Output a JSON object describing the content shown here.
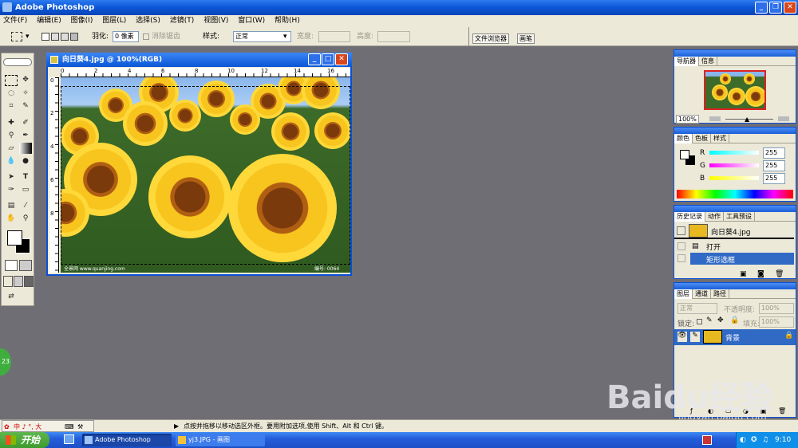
{
  "app": {
    "title": "Adobe Photoshop"
  },
  "menu": [
    "文件(F)",
    "编辑(E)",
    "图像(I)",
    "图层(L)",
    "选择(S)",
    "滤镜(T)",
    "视图(V)",
    "窗口(W)",
    "帮助(H)"
  ],
  "options": {
    "feather_label": "羽化:",
    "feather_value": "0 像素",
    "antialias_label": "消除锯齿",
    "style_label": "样式:",
    "style_value": "正常",
    "width_label": "宽度:",
    "height_label": "高度:",
    "palette_well": [
      "文件浏览器",
      "画笔"
    ]
  },
  "document": {
    "title": "向日葵4.jpg @ 100%(RGB)",
    "ruler_marks": [
      "0",
      "2",
      "4",
      "6",
      "8",
      "10",
      "12",
      "14",
      "16"
    ],
    "v_ruler_marks": [
      "0",
      "2",
      "4",
      "6",
      "8"
    ],
    "watermark_left": "全景网 www.quanjing.com",
    "watermark_right": "编号: 0064"
  },
  "navigator": {
    "tabs": [
      "导航器",
      "信息"
    ],
    "zoom": "100%"
  },
  "color": {
    "tabs": [
      "颜色",
      "色板",
      "样式"
    ],
    "channels": [
      {
        "label": "R",
        "value": "255",
        "color": "#e0302a"
      },
      {
        "label": "G",
        "value": "255",
        "color": "#2fb53a"
      },
      {
        "label": "B",
        "value": "255",
        "color": "#2a3fe0"
      }
    ]
  },
  "history": {
    "tabs": [
      "历史记录",
      "动作",
      "工具预设"
    ],
    "snapshot": "向日葵4.jpg",
    "items": [
      "打开",
      "矩形选框"
    ]
  },
  "layers": {
    "tabs": [
      "图层",
      "通道",
      "路径"
    ],
    "blend_mode": "正常",
    "opacity_label": "不透明度:",
    "opacity_value": "100%",
    "lock_label": "锁定:",
    "fill_label": "填充:",
    "fill_value": "100%",
    "layer_name": "背景"
  },
  "status": {
    "hint": "点按并拖移以移动选区外框。要用附加选项,使用 Shift、Alt 和 Ctrl 键。"
  },
  "ime": {
    "text": "中 ♪ °, 大"
  },
  "badge": "23",
  "watermark": {
    "brand": "Baidu经验",
    "url": "jingyan.baidu.com"
  },
  "taskbar": {
    "start": "开始",
    "tasks": [
      "Adobe Photoshop",
      "yj3.JPG - 画图"
    ],
    "clock": "9:10"
  }
}
